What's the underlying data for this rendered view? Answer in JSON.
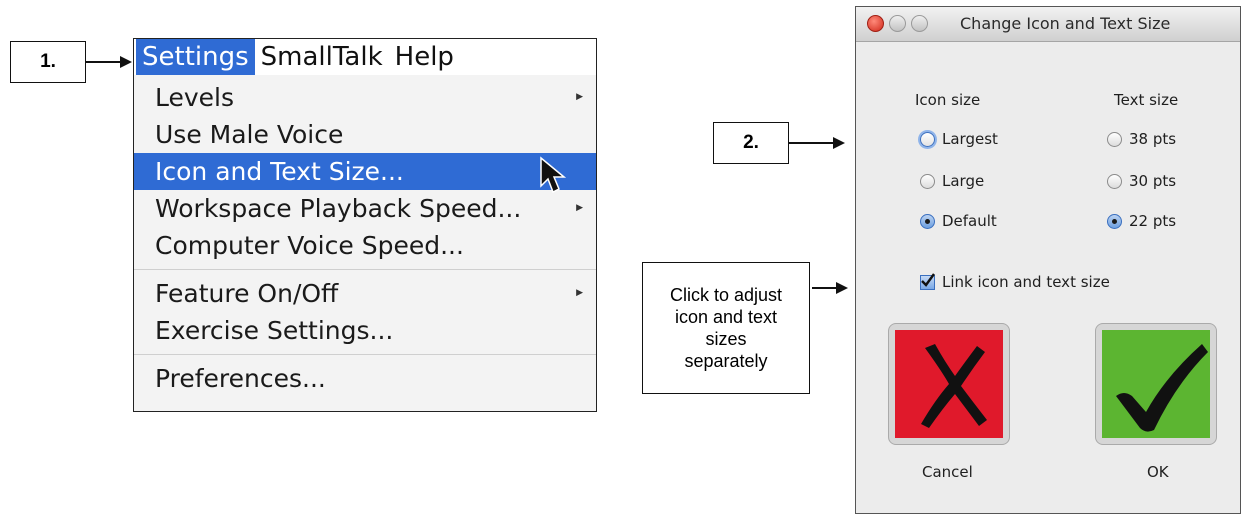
{
  "callouts": {
    "step1": "1.",
    "step2": "2.",
    "note": "Click to adjust icon and text sizes separately"
  },
  "menubar": {
    "items": [
      "Settings",
      "SmallTalk",
      "Help"
    ],
    "active": "Settings"
  },
  "menu": {
    "items": [
      {
        "label": "Levels",
        "submenu": true
      },
      {
        "label": "Use Male Voice",
        "submenu": false
      },
      {
        "label": "Icon and Text Size...",
        "submenu": false,
        "highlighted": true
      },
      {
        "label": "Workspace Playback Speed...",
        "submenu": true
      },
      {
        "label": "Computer Voice Speed...",
        "submenu": false
      },
      {
        "label": "Feature On/Off",
        "submenu": true
      },
      {
        "label": "Exercise Settings...",
        "submenu": false
      },
      {
        "label": "Preferences...",
        "submenu": false
      }
    ]
  },
  "dialog": {
    "title": "Change Icon and Text Size",
    "icon_size_label": "Icon size",
    "text_size_label": "Text size",
    "icon_options": [
      "Largest",
      "Large",
      "Default"
    ],
    "icon_selected": "Default",
    "text_options": [
      "38 pts",
      "30 pts",
      "22 pts"
    ],
    "text_selected": "22 pts",
    "link_label": "Link icon and text size",
    "link_checked": true,
    "cancel_label": "Cancel",
    "ok_label": "OK"
  },
  "colors": {
    "menu_highlight": "#2f6bd4",
    "cancel_button": "#e0192b",
    "ok_button": "#5cb531"
  }
}
